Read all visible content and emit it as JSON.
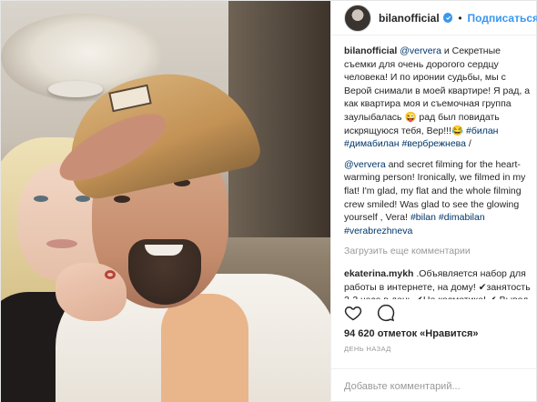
{
  "post": {
    "username": "bilanofficial",
    "separator": "•",
    "follow_label": "Подписаться",
    "caption": {
      "user": "bilanofficial",
      "mention": "@ververa",
      "text_ru": " и Секретные съемки для очень дорогого сердцу человека! И по иронии судьбы, мы с Верой снимали в моей квартире! Я рад, а как квартира моя и съемочная группа заулыбалась 😜 рад был повидать искрящуюся тебя, Вер!!!😂",
      "tags_ru": "#билан #димабилан #вербрежнева",
      "slash": " /",
      "mention_en": "@ververa",
      "text_en": " and secret filming for the heart-warming person! Ironically, we filmed in my flat! I'm glad, my flat and the whole filming crew smiled! Was glad to see the glowing yourself , Vera! ",
      "tags_en": "#bilan #dimabilan #verabrezhneva"
    },
    "load_more": "Загрузить еще комментарии",
    "comment": {
      "user": "ekaterina.mykh",
      "text": " .Объявляется набор для работы в интернете, на дому! ✔занятость 2-3 часа в день ✔Не косметика! ✔ Вывод средств моментально на вашу карту."
    },
    "likes": "94 620 отметок «Нравится»",
    "time": "ДЕНЬ НАЗАД",
    "add_comment_placeholder": "Добавьте комментарий...",
    "icons": {
      "like": "heart-icon",
      "comment": "comment-icon",
      "verified": "verified-badge-icon"
    },
    "colors": {
      "link": "#3897f0",
      "hashtag": "#003569",
      "muted": "#999999"
    }
  }
}
